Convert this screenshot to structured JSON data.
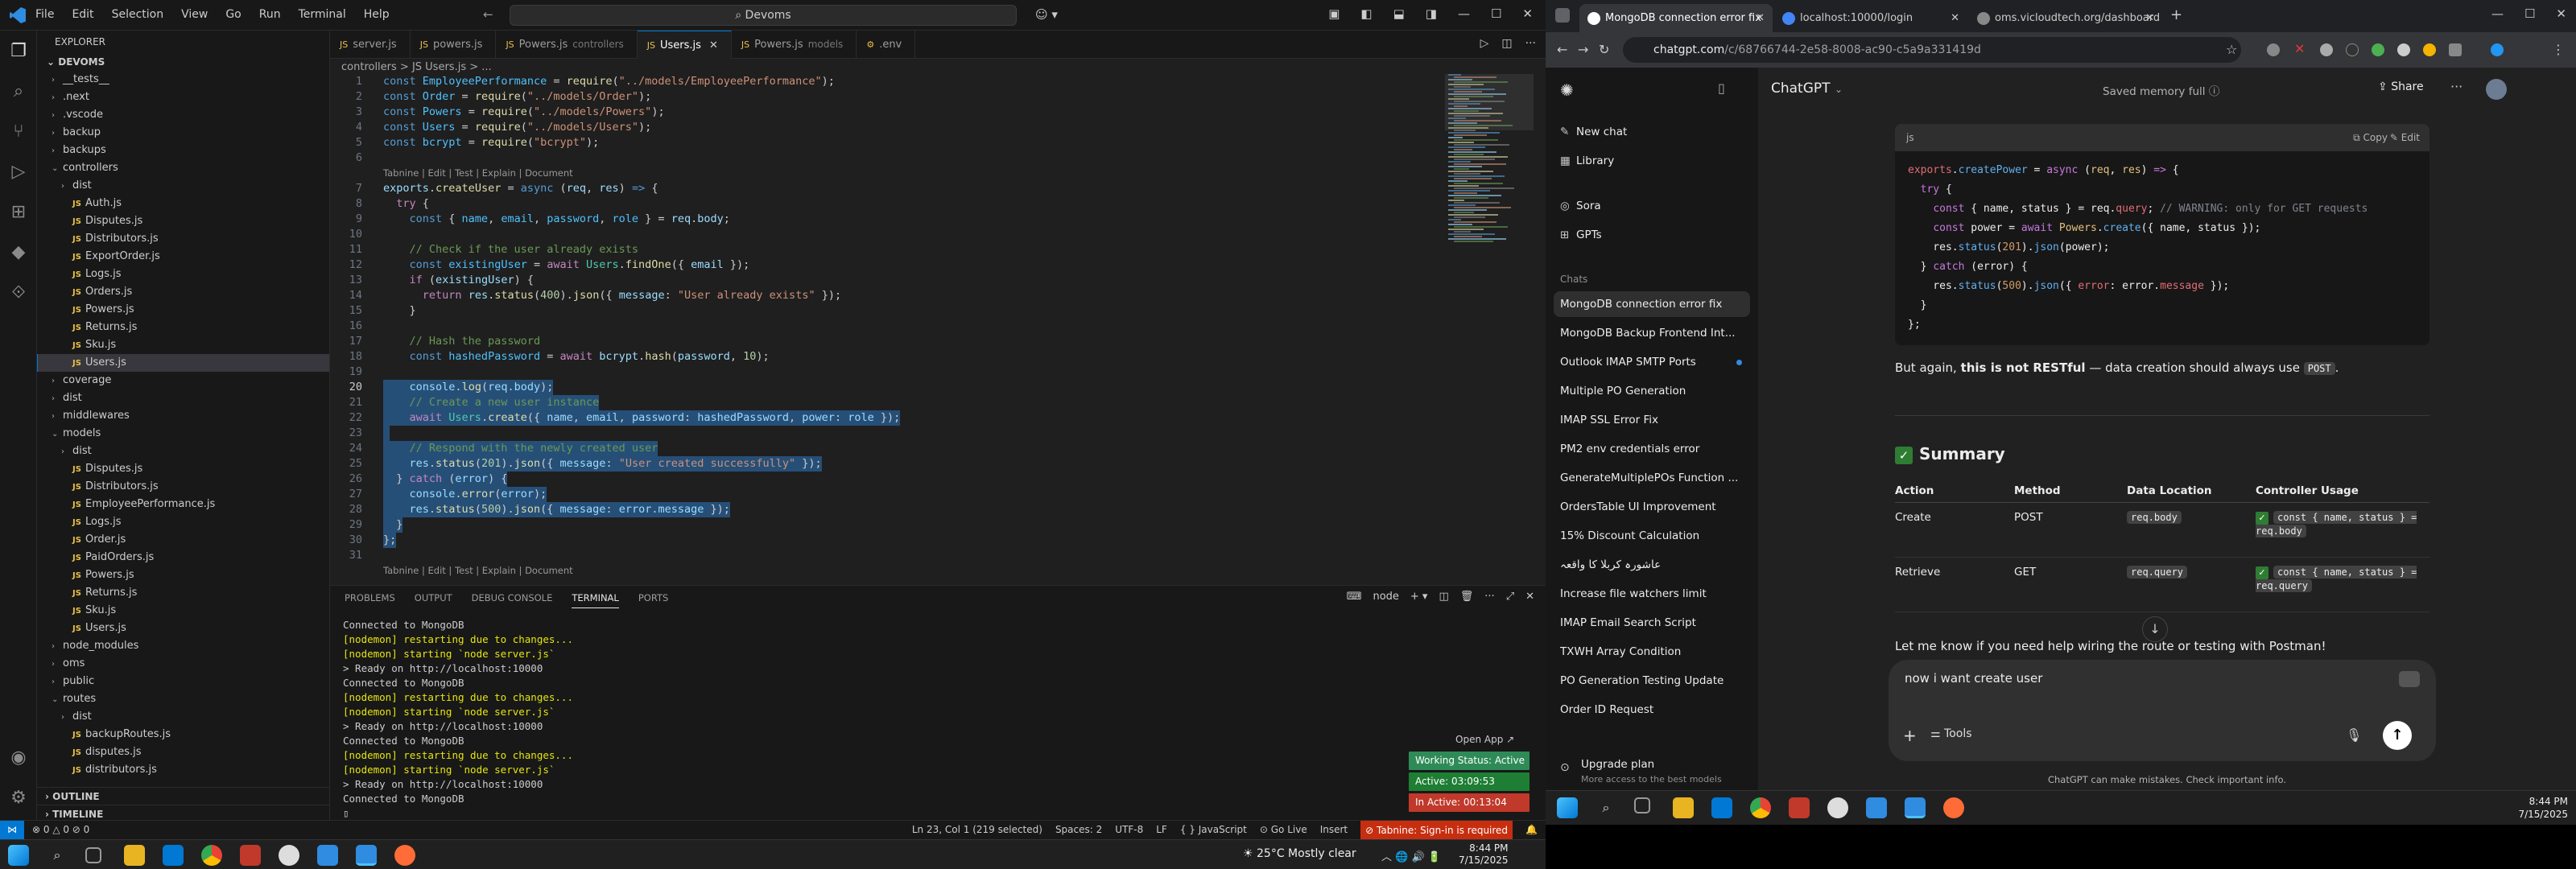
{
  "vscode": {
    "menu": [
      "File",
      "Edit",
      "Selection",
      "View",
      "Go",
      "Run",
      "Terminal",
      "Help"
    ],
    "search": "Devoms",
    "explorer_title": "EXPLORER",
    "root": "DEVOMS",
    "tree": [
      {
        "label": "__tests__",
        "type": "folder",
        "depth": 1,
        "arrow": "›"
      },
      {
        "label": ".next",
        "type": "folder",
        "depth": 1,
        "arrow": "›"
      },
      {
        "label": ".vscode",
        "type": "folder",
        "depth": 1,
        "arrow": "›"
      },
      {
        "label": "backup",
        "type": "folder",
        "depth": 1,
        "arrow": "›"
      },
      {
        "label": "backups",
        "type": "folder",
        "depth": 1,
        "arrow": "›"
      },
      {
        "label": "controllers",
        "type": "folder",
        "depth": 1,
        "arrow": "⌄"
      },
      {
        "label": "dist",
        "type": "folder",
        "depth": 2,
        "arrow": "›"
      },
      {
        "label": "Auth.js",
        "type": "file",
        "depth": 2
      },
      {
        "label": "Disputes.js",
        "type": "file",
        "depth": 2
      },
      {
        "label": "Distributors.js",
        "type": "file",
        "depth": 2
      },
      {
        "label": "ExportOrder.js",
        "type": "file",
        "depth": 2
      },
      {
        "label": "Logs.js",
        "type": "file",
        "depth": 2
      },
      {
        "label": "Orders.js",
        "type": "file",
        "depth": 2
      },
      {
        "label": "Powers.js",
        "type": "file",
        "depth": 2
      },
      {
        "label": "Returns.js",
        "type": "file",
        "depth": 2
      },
      {
        "label": "Sku.js",
        "type": "file",
        "depth": 2
      },
      {
        "label": "Users.js",
        "type": "file",
        "depth": 2,
        "selected": true
      },
      {
        "label": "coverage",
        "type": "folder",
        "depth": 1,
        "arrow": "›"
      },
      {
        "label": "dist",
        "type": "folder",
        "depth": 1,
        "arrow": "›"
      },
      {
        "label": "middlewares",
        "type": "folder",
        "depth": 1,
        "arrow": "›"
      },
      {
        "label": "models",
        "type": "folder",
        "depth": 1,
        "arrow": "⌄"
      },
      {
        "label": "dist",
        "type": "folder",
        "depth": 2,
        "arrow": "›"
      },
      {
        "label": "Disputes.js",
        "type": "file",
        "depth": 2
      },
      {
        "label": "Distributors.js",
        "type": "file",
        "depth": 2
      },
      {
        "label": "EmployeePerformance.js",
        "type": "file",
        "depth": 2
      },
      {
        "label": "Logs.js",
        "type": "file",
        "depth": 2
      },
      {
        "label": "Order.js",
        "type": "file",
        "depth": 2
      },
      {
        "label": "PaidOrders.js",
        "type": "file",
        "depth": 2
      },
      {
        "label": "Powers.js",
        "type": "file",
        "depth": 2
      },
      {
        "label": "Returns.js",
        "type": "file",
        "depth": 2
      },
      {
        "label": "Sku.js",
        "type": "file",
        "depth": 2
      },
      {
        "label": "Users.js",
        "type": "file",
        "depth": 2
      },
      {
        "label": "node_modules",
        "type": "folder",
        "depth": 1,
        "arrow": "›"
      },
      {
        "label": "oms",
        "type": "folder",
        "depth": 1,
        "arrow": "›"
      },
      {
        "label": "public",
        "type": "folder",
        "depth": 1,
        "arrow": "›"
      },
      {
        "label": "routes",
        "type": "folder",
        "depth": 1,
        "arrow": "⌄"
      },
      {
        "label": "dist",
        "type": "folder",
        "depth": 2,
        "arrow": "›"
      },
      {
        "label": "backupRoutes.js",
        "type": "file",
        "depth": 2
      },
      {
        "label": "disputes.js",
        "type": "file",
        "depth": 2
      },
      {
        "label": "distributors.js",
        "type": "file",
        "depth": 2
      }
    ],
    "outline": "OUTLINE",
    "timeline": "TIMELINE",
    "tabs": [
      {
        "label": "server.js",
        "dir": ""
      },
      {
        "label": "powers.js",
        "dir": ""
      },
      {
        "label": "Powers.js",
        "dir": "controllers"
      },
      {
        "label": "Users.js",
        "dir": "",
        "active": true
      },
      {
        "label": "Powers.js",
        "dir": "models"
      },
      {
        "label": ".env",
        "dir": "",
        "icon": "gear"
      }
    ],
    "breadcrumb": "controllers > JS Users.js > ...",
    "codelens": "Tabnine | Edit | Test | Explain | Document",
    "panel_tabs": [
      "PROBLEMS",
      "OUTPUT",
      "DEBUG CONSOLE",
      "TERMINAL",
      "PORTS"
    ],
    "panel_active": "TERMINAL",
    "terminal_label": "node",
    "terminal": [
      "Connected to MongoDB",
      "[nodemon] restarting due to changes...",
      "[nodemon] starting `node server.js`",
      "> Ready on http://localhost:10000",
      "Connected to MongoDB",
      "[nodemon] restarting due to changes...",
      "[nodemon] starting `node server.js`",
      "> Ready on http://localhost:10000",
      "Connected to MongoDB",
      "[nodemon] restarting due to changes...",
      "[nodemon] starting `node server.js`",
      "> Ready on http://localhost:10000",
      "Connected to MongoDB"
    ],
    "open_app": "Open App ↗",
    "status_boxes": [
      {
        "label": "Working Status: Active",
        "color": "#2e8b57"
      },
      {
        "label": "Active: 03:09:53",
        "color": "#1e7e34"
      },
      {
        "label": "In Active: 00:13:04",
        "color": "#c0392b"
      }
    ],
    "statusbar": {
      "left": "⊗ 0 △ 0   ⊘ 0",
      "position": "Ln 23, Col 1 (219 selected)",
      "spaces": "Spaces: 2",
      "encoding": "UTF-8",
      "eol": "LF",
      "language": "{ } JavaScript",
      "golive": "⊙ Go Live",
      "insert": "Insert",
      "tabnine": "⊘ Tabnine: Sign-in is required"
    }
  },
  "taskbar_left": {
    "weather": "25°C  Mostly clear",
    "time": "8:44 PM",
    "date": "7/15/2025"
  },
  "browser": {
    "tabs": [
      {
        "label": "MongoDB connection error fix",
        "active": true,
        "color": "#ffffff"
      },
      {
        "label": "localhost:10000/login",
        "color": "#4285f4"
      },
      {
        "label": "oms.vicloudtech.org/dashboard",
        "color": "#888888"
      }
    ],
    "url_host": "chatgpt.com",
    "url_path": "/c/68766744-2e58-8008-ac90-c5a9a331419d"
  },
  "chatgpt": {
    "sidebar_top": [
      {
        "label": "New chat",
        "icon": "✎"
      },
      {
        "label": "Library",
        "icon": "▦"
      },
      {
        "label": "Sora",
        "icon": "◎"
      },
      {
        "label": "GPTs",
        "icon": "⊞"
      }
    ],
    "chats_heading": "Chats",
    "chats": [
      "MongoDB connection error fix",
      "MongoDB Backup Frontend Int...",
      "Outlook IMAP SMTP Ports",
      "Multiple PO Generation",
      "IMAP SSL Error Fix",
      "PM2 env credentials error",
      "GenerateMultiplePOs Function ...",
      "OrdersTable UI Improvement",
      "15% Discount Calculation",
      "عاشورہ کربلا کا واقعہ",
      "Increase file watchers limit",
      "IMAP Email Search Script",
      "TXWH Array Condition",
      "PO Generation Testing Update",
      "Order ID Request"
    ],
    "upgrade_title": "Upgrade plan",
    "upgrade_sub": "More access to the best models",
    "model": "ChatGPT",
    "memory": "Saved memory full",
    "share": "Share",
    "code_lang": "js",
    "copy": "Copy",
    "edit": "Edit",
    "not_restful_pre": "But again, ",
    "not_restful_bold": "this is not RESTful",
    "not_restful_post": " — data creation should always use ",
    "not_restful_code": "POST",
    "summary_title": "Summary",
    "table_headers": [
      "Action",
      "Method",
      "Data Location",
      "Controller Usage"
    ],
    "table_rows": [
      {
        "action": "Create",
        "method": "POST",
        "location": "req.body",
        "usage": "const { name, status } = req.body"
      },
      {
        "action": "Retrieve",
        "method": "GET",
        "location": "req.query",
        "usage": "const { name, status } = req.query"
      }
    ],
    "closing": "Let me know if you need help wiring the route or testing with Postman!",
    "input_text": "now i want create user",
    "tools": "Tools",
    "disclaimer": "ChatGPT can make mistakes. Check important info."
  },
  "taskbar_right": {
    "time": "8:44 PM",
    "date": "7/15/2025"
  }
}
